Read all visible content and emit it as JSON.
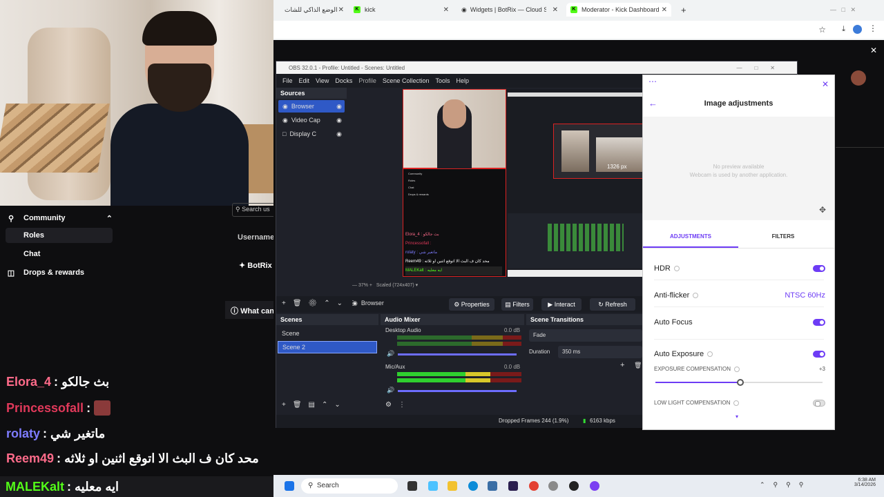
{
  "left_nav": {
    "community": "Community",
    "roles": "Roles",
    "chat": "Chat",
    "drops": "Drops & rewards",
    "behind_search": "Search us",
    "behind_username": "Username",
    "behind_bot": "BotRix",
    "behind_what": "What can"
  },
  "chat_lines": [
    {
      "user": "Elora_4",
      "sep": ":",
      "msg": "بث جالكو",
      "color": "#ff6b8a"
    },
    {
      "user": "Princessofall",
      "sep": ":",
      "msg": "",
      "color": "#e0395a"
    },
    {
      "user": "rolaty",
      "sep": ":",
      "msg": "ماتغير شي",
      "color": "#7e7cff"
    },
    {
      "user": "Reem49",
      "sep": ":",
      "msg": "محد كان ف البث الا اتوقع اثنين او ثلاثه",
      "color": "#ff6b8a"
    },
    {
      "user": "MALEKalt",
      "sep": ":",
      "msg": "ايه معليه",
      "color": "#53fc18"
    }
  ],
  "browser": {
    "tabs": [
      {
        "label": "الوضع الذاكي للشات"
      },
      {
        "label": "kick"
      },
      {
        "label": "Widgets | BotRix — Cloud Strea"
      },
      {
        "label": "Moderator - Kick Dashboard"
      }
    ]
  },
  "obs": {
    "title": "OBS 32.0.1 - Profile: Untitled - Scenes: Untitled",
    "menu": [
      "File",
      "Edit",
      "View",
      "Docks",
      "Profile",
      "Scene Collection",
      "Tools",
      "Help"
    ],
    "sources_title": "Sources",
    "sources": [
      "Browser",
      "Video Cap",
      "Display C"
    ],
    "zoom": "37%",
    "scaled": "Scaled (724x407)",
    "px_label": "1326 px",
    "source_name": "Browser",
    "properties": "Properties",
    "filters": "Filters",
    "interact": "Interact",
    "refresh": "Refresh",
    "scenes_title": "Scenes",
    "scenes": [
      "Scene",
      "Scene 2"
    ],
    "mixer_title": "Audio Mixer",
    "desktop_audio": "Desktop Audio",
    "mic_aux": "Mic/Aux",
    "db0": "0.0 dB",
    "db1": "0.0 dB",
    "transitions_title": "Scene Transitions",
    "transition": "Fade",
    "duration_label": "Duration",
    "duration": "350 ms",
    "status": "Dropped Frames 244 (1.9%)",
    "kbps": "6163 kbps",
    "mini_chat": [
      "Elora_4 : بث جالكو",
      "Princessofall :",
      "rolaty : ماتغير شي",
      "Reem49 : محد كان ف البث الا اتوقع اثنين او ثلاثه",
      "MALEKalt : ايه معليه"
    ],
    "mini_nav": [
      "Community",
      "Roles",
      "Chat",
      "Drops & rewards"
    ]
  },
  "adjust": {
    "title": "Image adjustments",
    "no_preview": "No preview available",
    "webcam_used": "Webcam is used by another application.",
    "tab_adjust": "ADJUSTMENTS",
    "tab_filters": "FILTERS",
    "hdr": "HDR",
    "antiflicker": "Anti-flicker",
    "antiflicker_value": "NTSC 60Hz",
    "autofocus": "Auto Focus",
    "autoexposure": "Auto Exposure",
    "exposure_comp": "EXPOSURE COMPENSATION",
    "exposure_value": "+3",
    "exposure_level": 0.51,
    "lowlight": "LOW LIGHT COMPENSATION",
    "accent": "#6d3cf5"
  },
  "taskbar": {
    "search": "Search",
    "time": "6:38 AM",
    "date": "3/14/2026"
  }
}
